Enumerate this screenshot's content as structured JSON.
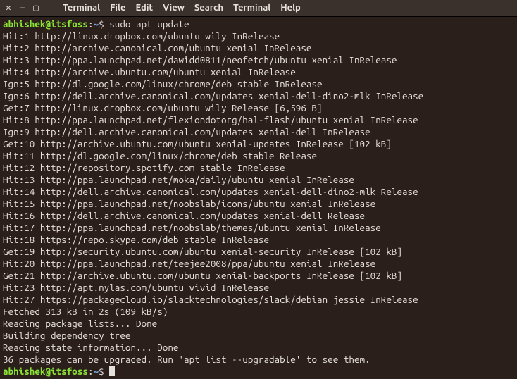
{
  "titlebar": {
    "close_glyph": "✕",
    "minimize_glyph": "—",
    "maximize_glyph": "▢"
  },
  "menubar": {
    "items": [
      "Terminal",
      "File",
      "Edit",
      "View",
      "Search",
      "Terminal",
      "Help"
    ]
  },
  "prompt": {
    "user": "abhishek",
    "at": "@",
    "host": "itsfoss",
    "colon": ":",
    "path": "~",
    "symbol": "$"
  },
  "command": "sudo apt update",
  "output": [
    "Hit:1 http://linux.dropbox.com/ubuntu wily InRelease",
    "Hit:2 http://archive.canonical.com/ubuntu xenial InRelease",
    "Hit:3 http://ppa.launchpad.net/dawidd0811/neofetch/ubuntu xenial InRelease",
    "Hit:4 http://archive.ubuntu.com/ubuntu xenial InRelease",
    "Ign:5 http://dl.google.com/linux/chrome/deb stable InRelease",
    "Ign:6 http://dell.archive.canonical.com/updates xenial-dell-dino2-mlk InRelease",
    "Get:7 http://linux.dropbox.com/ubuntu wily Release [6,596 B]",
    "Hit:8 http://ppa.launchpad.net/flexiondotorg/hal-flash/ubuntu xenial InRelease",
    "Ign:9 http://dell.archive.canonical.com/updates xenial-dell InRelease",
    "Get:10 http://archive.ubuntu.com/ubuntu xenial-updates InRelease [102 kB]",
    "Hit:11 http://dl.google.com/linux/chrome/deb stable Release",
    "Hit:12 http://repository.spotify.com stable InRelease",
    "Hit:13 http://ppa.launchpad.net/moka/daily/ubuntu xenial InRelease",
    "Hit:14 http://dell.archive.canonical.com/updates xenial-dell-dino2-mlk Release",
    "Hit:15 http://ppa.launchpad.net/noobslab/icons/ubuntu xenial InRelease",
    "Hit:16 http://dell.archive.canonical.com/updates xenial-dell Release",
    "Hit:17 http://ppa.launchpad.net/noobslab/themes/ubuntu xenial InRelease",
    "Hit:18 https://repo.skype.com/deb stable InRelease",
    "Get:19 http://security.ubuntu.com/ubuntu xenial-security InRelease [102 kB]",
    "Hit:20 http://ppa.launchpad.net/teejee2008/ppa/ubuntu xenial InRelease",
    "Get:21 http://archive.ubuntu.com/ubuntu xenial-backports InRelease [102 kB]",
    "Hit:23 http://apt.nylas.com/ubuntu vivid InRelease",
    "Hit:27 https://packagecloud.io/slacktechnologies/slack/debian jessie InRelease",
    "Fetched 313 kB in 2s (109 kB/s)",
    "Reading package lists... Done",
    "Building dependency tree",
    "Reading state information... Done",
    "36 packages can be upgraded. Run 'apt list --upgradable' to see them."
  ]
}
